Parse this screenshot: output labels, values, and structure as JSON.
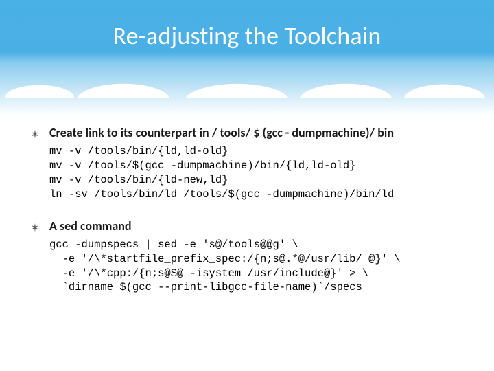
{
  "title": "Re-adjusting the Toolchain",
  "bullets": [
    {
      "head": "Create link to its counterpart in / tools/ $ (gcc - dumpmachine)/ bin",
      "code": "mv -v /tools/bin/{ld,ld-old}\nmv -v /tools/$(gcc -dumpmachine)/bin/{ld,ld-old}\nmv -v /tools/bin/{ld-new,ld}\nln -sv /tools/bin/ld /tools/$(gcc -dumpmachine)/bin/ld"
    },
    {
      "head": "A sed command",
      "code": "gcc -dumpspecs | sed -e 's@/tools@@g' \\\n  -e '/\\*startfile_prefix_spec:/{n;s@.*@/usr/lib/ @}' \\\n  -e '/\\*cpp:/{n;s@$@ -isystem /usr/include@}' > \\\n  `dirname $(gcc --print-libgcc-file-name)`/specs"
    }
  ]
}
